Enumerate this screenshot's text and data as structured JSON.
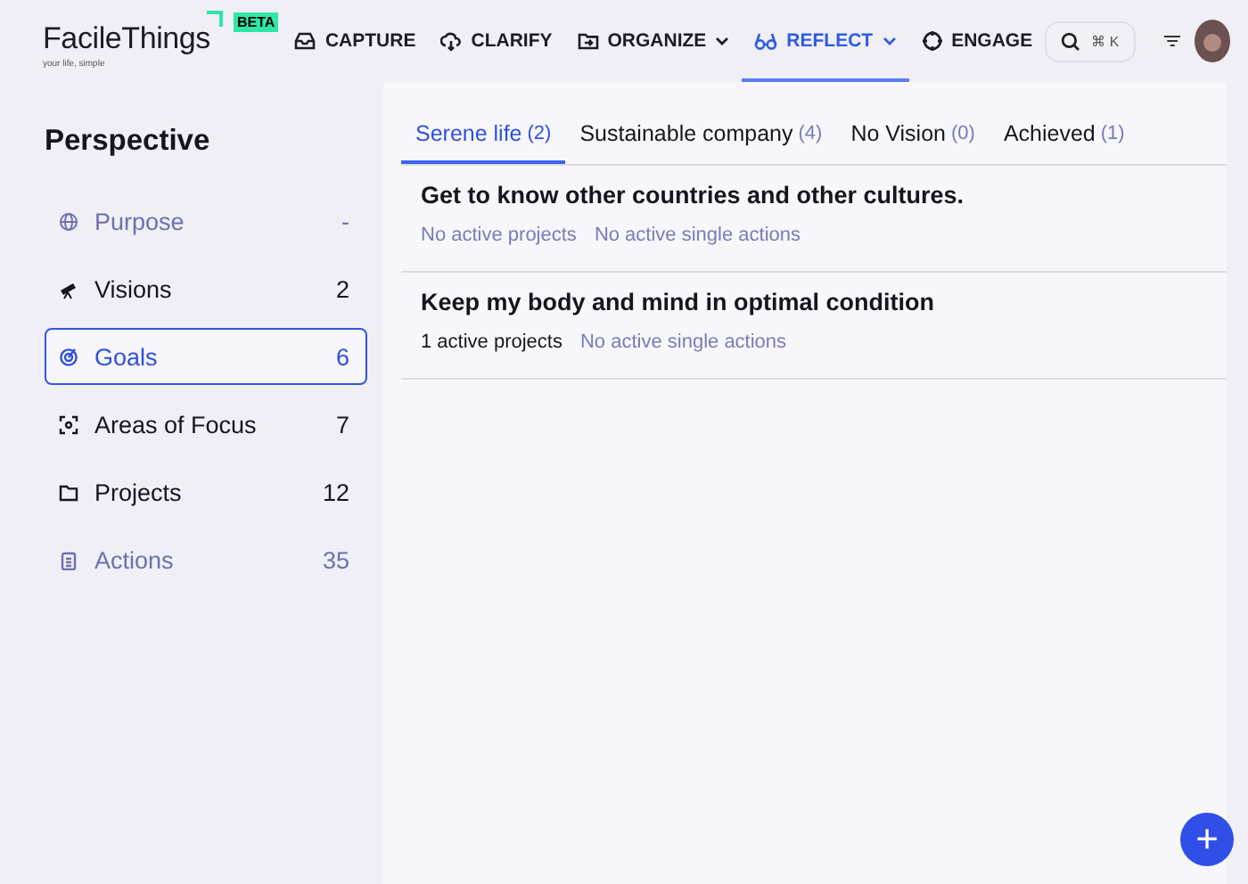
{
  "logo": {
    "name": "FacileThings",
    "badge": "BETA",
    "tagline": "your life, simple"
  },
  "nav": [
    {
      "label": "CAPTURE",
      "dropdown": false,
      "selected": false
    },
    {
      "label": "CLARIFY",
      "dropdown": false,
      "selected": false
    },
    {
      "label": "ORGANIZE",
      "dropdown": true,
      "selected": false
    },
    {
      "label": "REFLECT",
      "dropdown": true,
      "selected": true
    },
    {
      "label": "ENGAGE",
      "dropdown": false,
      "selected": false
    }
  ],
  "search": {
    "shortcut": "⌘ K"
  },
  "sidebar": {
    "title": "Perspective",
    "items": [
      {
        "label": "Purpose",
        "count": "-",
        "muted": true,
        "selected": false
      },
      {
        "label": "Visions",
        "count": "2",
        "muted": false,
        "selected": false
      },
      {
        "label": "Goals",
        "count": "6",
        "muted": false,
        "selected": true
      },
      {
        "label": "Areas of Focus",
        "count": "7",
        "muted": false,
        "selected": false
      },
      {
        "label": "Projects",
        "count": "12",
        "muted": false,
        "selected": false
      },
      {
        "label": "Actions",
        "count": "35",
        "muted": true,
        "selected": false
      }
    ]
  },
  "tabs": [
    {
      "label": "Serene life",
      "count": "(2)",
      "selected": true
    },
    {
      "label": "Sustainable company",
      "count": "(4)",
      "selected": false
    },
    {
      "label": "No Vision",
      "count": "(0)",
      "selected": false
    },
    {
      "label": "Achieved",
      "count": "(1)",
      "selected": false
    }
  ],
  "goals": [
    {
      "title": "Get to know other countries and other cultures.",
      "stats": [
        {
          "text": "No active projects",
          "empty": true
        },
        {
          "text": "No active single actions",
          "empty": true
        }
      ]
    },
    {
      "title": "Keep my body and mind in optimal condition",
      "stats": [
        {
          "text": "1 active projects",
          "empty": false
        },
        {
          "text": "No active single actions",
          "empty": true
        }
      ]
    }
  ],
  "fab": {
    "symbol": "+"
  }
}
